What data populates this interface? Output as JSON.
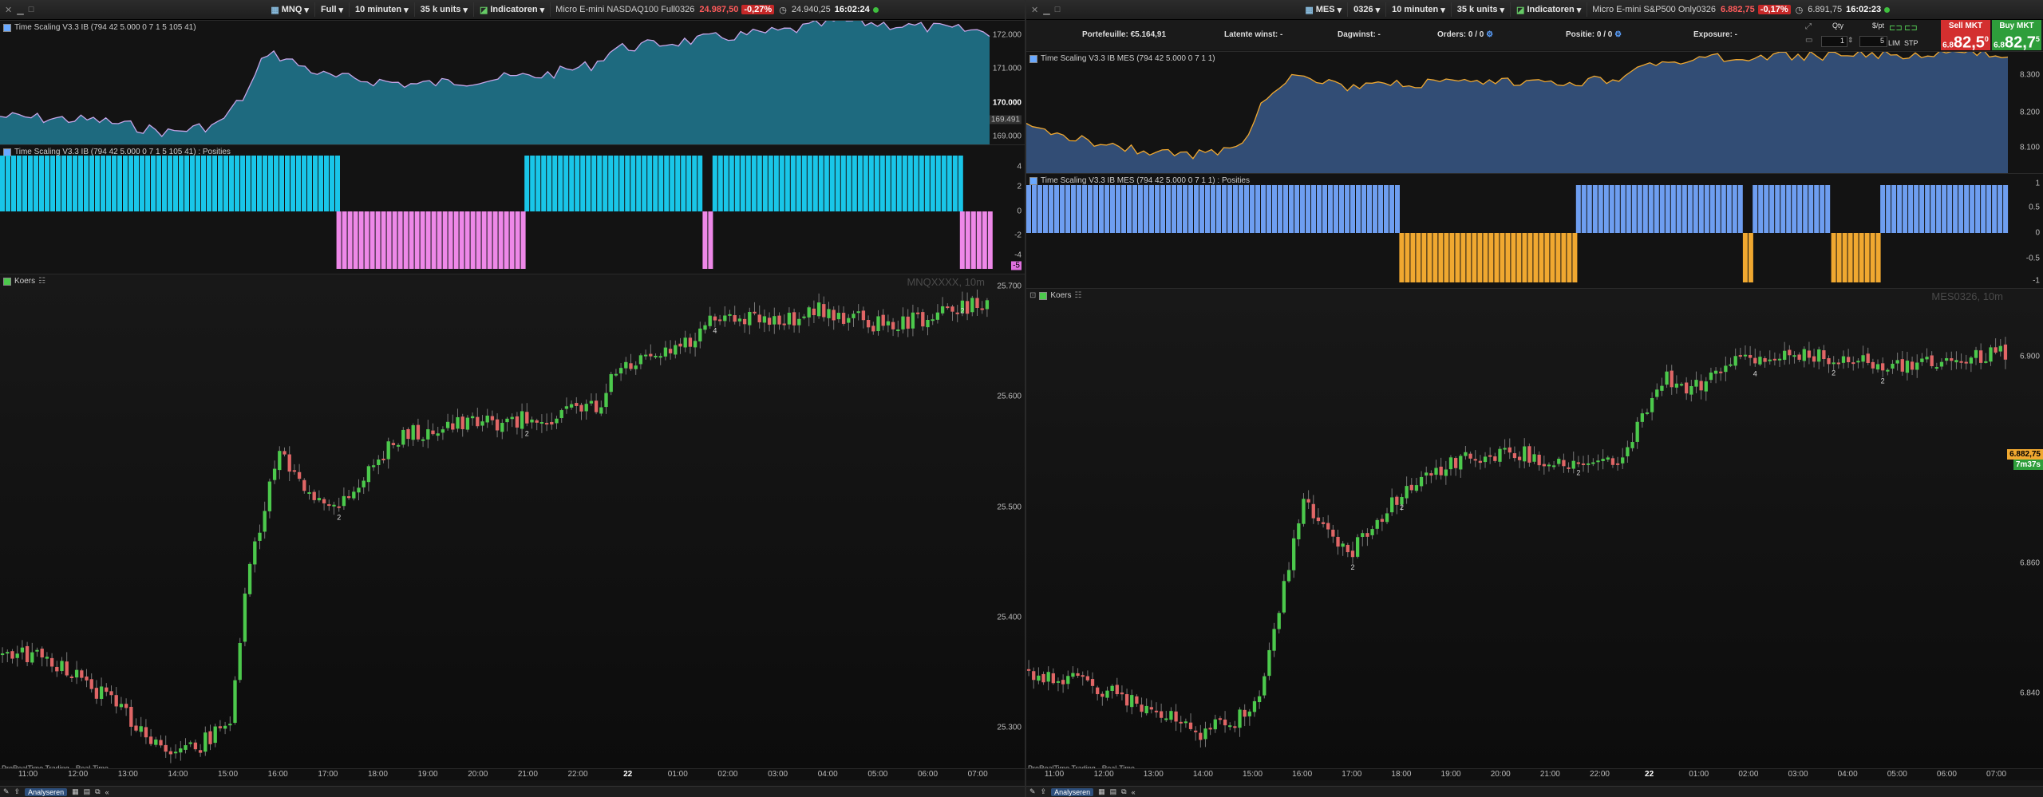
{
  "colors": {
    "bull": "#4cc94c",
    "bear": "#e06666",
    "cyan": "#19c6e8",
    "pink": "#ee88e8",
    "blue": "#6e9ef0",
    "orange": "#f0a830",
    "tealfill": "#1f6f85",
    "bluefill": "#34507a",
    "lineL": "#c7a6e8",
    "lineR": "#f0a830",
    "sell": "#d32f2f",
    "buy": "#2e9e3b"
  },
  "left": {
    "titlebar": {
      "symbol": "MNQ",
      "range": "Full",
      "timeframe": "10 minuten",
      "units": "35 k units",
      "indicators": "Indicatoren",
      "instrument": "Micro E-mini NASDAQ100 Full0326",
      "price": "24.987,50",
      "change": "-0,27%",
      "prev": "24.940,25",
      "time": "16:02:24"
    },
    "ind1": {
      "label": "Time Scaling V3.3 IB (794 42 5.000 0 7 1 5 105 41)",
      "y_labels": [
        "172.000",
        "171.000",
        "170.000",
        "169.491",
        "169.000"
      ]
    },
    "ind2": {
      "label": "Time Scaling V3.3 IB (794 42 5.000 0 7 1 5 105 41) : Posities",
      "y_labels": [
        "4",
        "2",
        "0",
        "-2",
        "-4",
        "-5"
      ]
    },
    "price": {
      "label": "Koers",
      "watermark": "MNQXXXX, 10m",
      "y_labels": [
        "25.700",
        "25.600",
        "25.500",
        "25.400",
        "25.300"
      ],
      "trade_marks": [
        "2",
        "2",
        "4",
        "2"
      ]
    },
    "x_labels": [
      "11:00",
      "12:00",
      "13:00",
      "14:00",
      "15:00",
      "16:00",
      "17:00",
      "18:00",
      "19:00",
      "20:00",
      "21:00",
      "22:00",
      "22",
      "01:00",
      "02:00",
      "03:00",
      "04:00",
      "05:00",
      "06:00",
      "07:00"
    ],
    "source": "ProRealTime Trading - Real-Time",
    "analyse": "Analyseren"
  },
  "right": {
    "titlebar": {
      "symbol": "MES",
      "range": "0326",
      "timeframe": "10 minuten",
      "units": "35 k units",
      "indicators": "Indicatoren",
      "instrument": "Micro E-mini S&P500 Only0326",
      "price": "6.882,75",
      "change": "-0,17%",
      "prev": "6.891,75",
      "time": "16:02:23"
    },
    "info": {
      "portfolio": "Portefeuille: €5.164,91",
      "latent": "Latente winst: -",
      "daily": "Dagwinst: -",
      "orders": "Orders: 0",
      "orders_of": "/ 0",
      "position": "Positie: 0",
      "position_of": "/ 0",
      "exposure": "Exposure: -",
      "qty_label": "Qty",
      "qty": "1",
      "pt_label": "$/pt",
      "pt": "5",
      "lim": "LIM",
      "stp": "STP",
      "sell_label": "Sell MKT",
      "sell_small": "6.8",
      "sell_price": "82,5",
      "sell_sup": "0",
      "buy_label": "Buy MKT",
      "buy_small": "6.8",
      "buy_price": "82,7",
      "buy_sup": "5"
    },
    "ind1": {
      "label": "Time Scaling V3.3 IB MES (794 42 5.000 0 7 1 1)",
      "y_labels": [
        "8.300",
        "8.200",
        "8.100"
      ]
    },
    "ind2": {
      "label": "Time Scaling V3.3 IB MES (794 42 5.000 0 7 1 1) : Posities",
      "y_labels": [
        "1",
        "0.5",
        "0",
        "-0.5",
        "-1"
      ]
    },
    "price": {
      "label": "Koers",
      "watermark": "MES0326, 10m",
      "y_labels": [
        "6.900",
        "6.880",
        "6.860",
        "6.840"
      ],
      "last_price": "6.882,75",
      "countdown": "7m37s",
      "trade_marks": [
        "2",
        "2",
        "2",
        "4",
        "2",
        "2"
      ]
    },
    "x_labels": [
      "11:00",
      "12:00",
      "13:00",
      "14:00",
      "15:00",
      "16:00",
      "17:00",
      "18:00",
      "19:00",
      "20:00",
      "21:00",
      "22:00",
      "22",
      "01:00",
      "02:00",
      "03:00",
      "04:00",
      "05:00",
      "06:00",
      "07:00"
    ],
    "source": "ProRealTime Trading - Real-Time",
    "analyse": "Analyseren"
  }
}
